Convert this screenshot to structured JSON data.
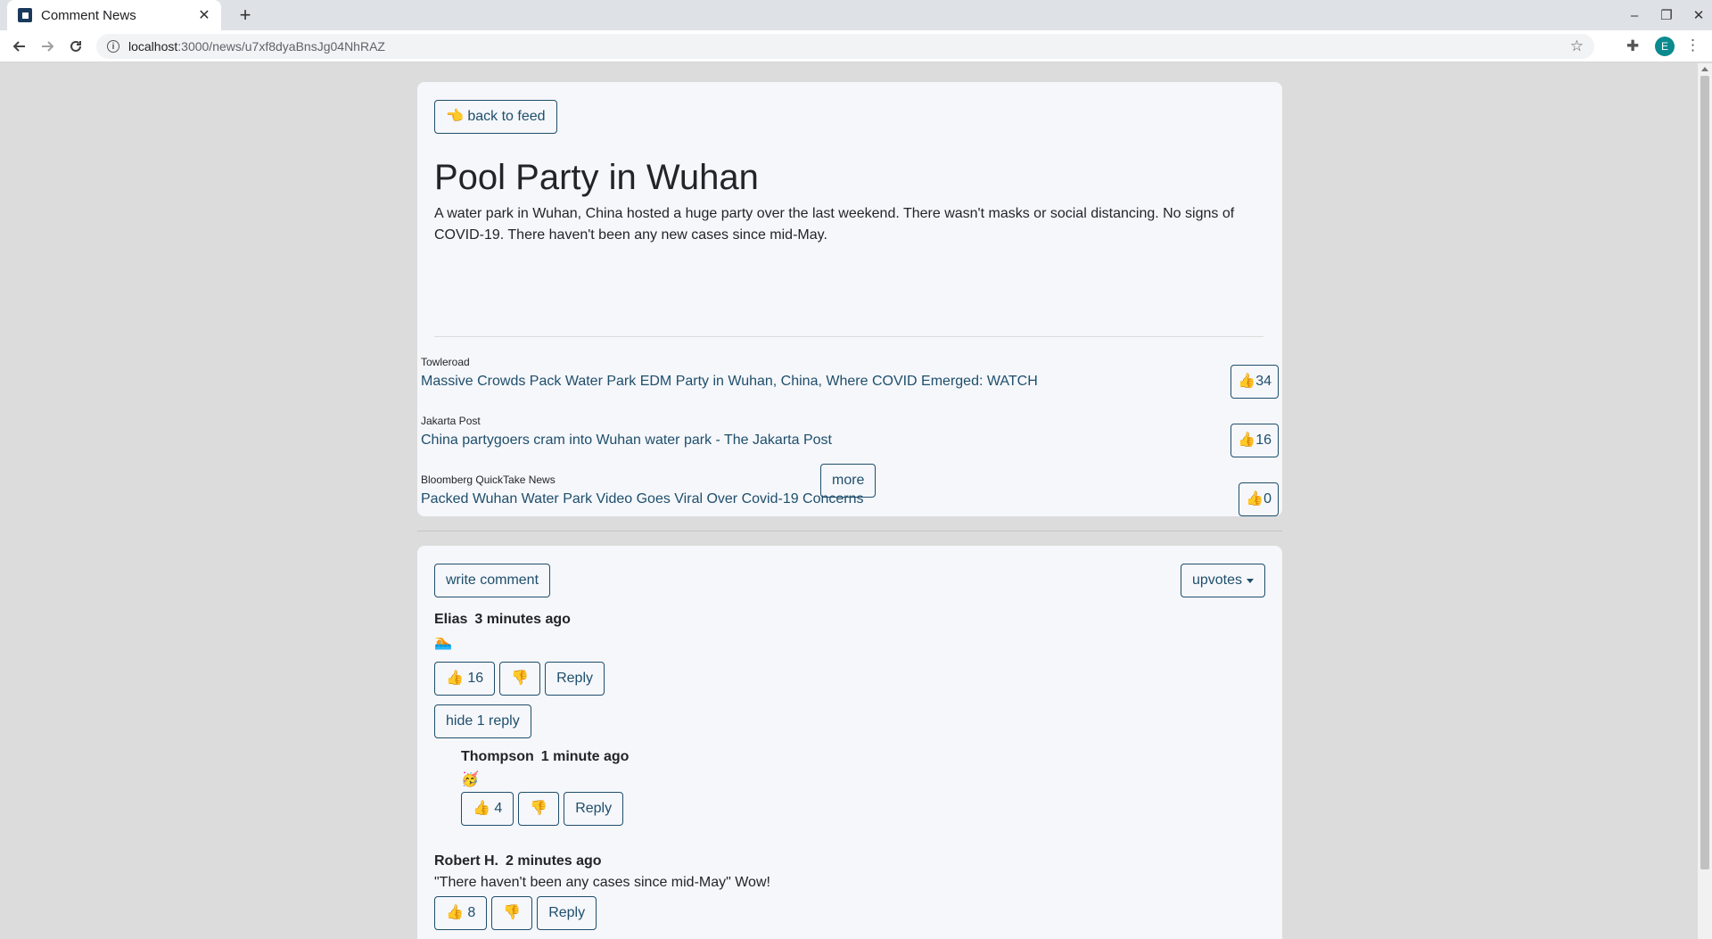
{
  "browser": {
    "tab_title": "Comment News",
    "url_host": "localhost",
    "url_path": ":3000/news/u7xf8dyaBnsJg04NhRAZ",
    "profile_initial": "E"
  },
  "news": {
    "back_label": "👈 back to feed",
    "title": "Pool Party in Wuhan",
    "description": "A water park in Wuhan, China hosted a huge party over the last weekend. There wasn't masks or social distancing. No signs of COVID-19. There haven't been any new cases since mid-May.",
    "sources": [
      {
        "name": "Towleroad",
        "headline": "Massive Crowds Pack Water Park EDM Party in Wuhan, China, Where COVID Emerged: WATCH",
        "votes": "👍34"
      },
      {
        "name": "Jakarta Post",
        "headline": "China partygoers cram into Wuhan water park - The Jakarta Post",
        "votes": "👍16"
      },
      {
        "name": "Bloomberg QuickTake News",
        "headline": "Packed Wuhan Water Park Video Goes Viral Over Covid-19 Concerns",
        "votes": "👍0"
      }
    ],
    "more_label": "more"
  },
  "comments": {
    "write_label": "write comment",
    "sort_label": "upvotes",
    "items": [
      {
        "author": "Elias",
        "time": "3 minutes ago",
        "body": "🏊",
        "upvote_label": "👍 16",
        "downvote_label": "👎",
        "reply_label": "Reply",
        "toggle_label": "hide 1 reply",
        "replies": [
          {
            "author": "Thompson",
            "time": "1 minute ago",
            "body": "🥳",
            "upvote_label": "👍 4",
            "downvote_label": "👎",
            "reply_label": "Reply"
          }
        ]
      },
      {
        "author": "Robert H.",
        "time": "2 minutes ago",
        "body": "\"There haven't been any cases since mid-May\" Wow!",
        "upvote_label": "👍 8",
        "downvote_label": "👎",
        "reply_label": "Reply"
      }
    ]
  }
}
